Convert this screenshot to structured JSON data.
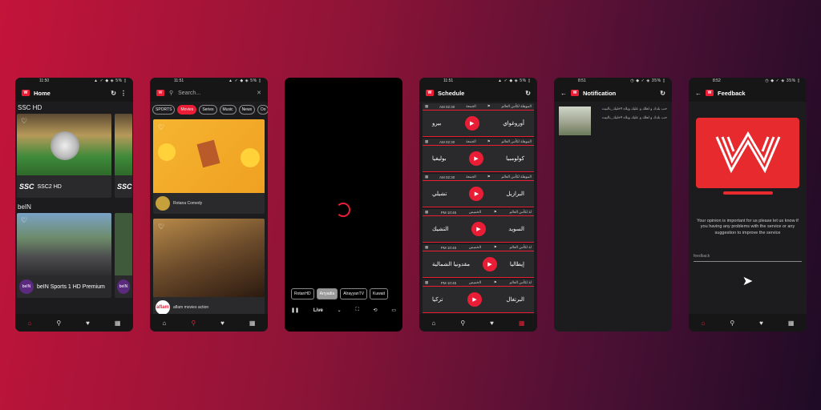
{
  "colors": {
    "accent": "#e91e36",
    "panel": "#1c1c1e",
    "card": "#2a2a2c"
  },
  "home": {
    "status_time": "11:50",
    "status_icons": "▲ ✓ ◆ ◈ 5% ▯",
    "title": "Home",
    "section1": "SSC HD",
    "section1_channel": "SSC2 HD",
    "section1_logo": "SSC",
    "section2": "beIN",
    "section2_channel": "beIN Sports 1 HD Premium",
    "section2_logo": "beIN"
  },
  "search": {
    "status_time": "11:51",
    "status_icons": "▲ ✓ ◆ ◈ 5% ▯",
    "placeholder": "Search...",
    "chips": [
      "SPORTS",
      "Movies",
      "Series",
      "Music",
      "News",
      "Do"
    ],
    "movie1_name": "Rotana Comedy",
    "movie2_name": "aflam movies action",
    "movie2_logo": "aflam"
  },
  "player": {
    "chips": [
      "RotanHD",
      "Arryadia",
      "AlrayyanTV",
      "Kuwait"
    ],
    "live_label": "Live"
  },
  "schedule": {
    "status_time": "11:51",
    "status_icons": "▲ ✓ ◆ ◈ 5% ▯",
    "title": "Schedule",
    "matches": [
      {
        "time": "AM 02:30",
        "day": "الجمعة",
        "comp": "الموهلة لكأس العالم",
        "team1": "أوروغواي",
        "team2": "بيرو"
      },
      {
        "time": "AM 02:30",
        "day": "الجمعة",
        "comp": "الموهلة لكأس العالم",
        "team1": "كولومبيا",
        "team2": "بوليفيا"
      },
      {
        "time": "AM 02:30",
        "day": "الجمعة",
        "comp": "الموهلة لكأس العالم",
        "team1": "البرازيل",
        "team2": "تشيلي"
      },
      {
        "time": "PM 10:45",
        "day": "الخميس",
        "comp": "لة لكأس العالم",
        "team1": "السويد",
        "team2": "التشيك"
      },
      {
        "time": "PM 10:45",
        "day": "الخميس",
        "comp": "لة لكأس العالم",
        "team1": "إيطاليا",
        "team2": "مقدونيا الشمالية"
      },
      {
        "time": "PM 10:45",
        "day": "الخميس",
        "comp": "لة لكأس العالم",
        "team1": "البرتغال",
        "team2": "تركيا"
      }
    ]
  },
  "notification": {
    "status_time": "8:51",
    "status_icons": "◷ ◆ ✓ ◈ 35% ▯",
    "title": "Notification",
    "line1": "حب بلدك و اهلك و عليك ويلاه #خليك_بالبيت",
    "line2": "حب بلدك و اهلك و عليك ويلاه #خليك_بالبيت"
  },
  "feedback": {
    "status_time": "8:52",
    "status_icons": "◷ ◆ ✓ ◈ 35% ▯",
    "title": "Feedback",
    "message": "Your opinion is important for us please let us know if you having any problems with the service or any suggestion to improve the service",
    "input_placeholder": "feedback"
  }
}
